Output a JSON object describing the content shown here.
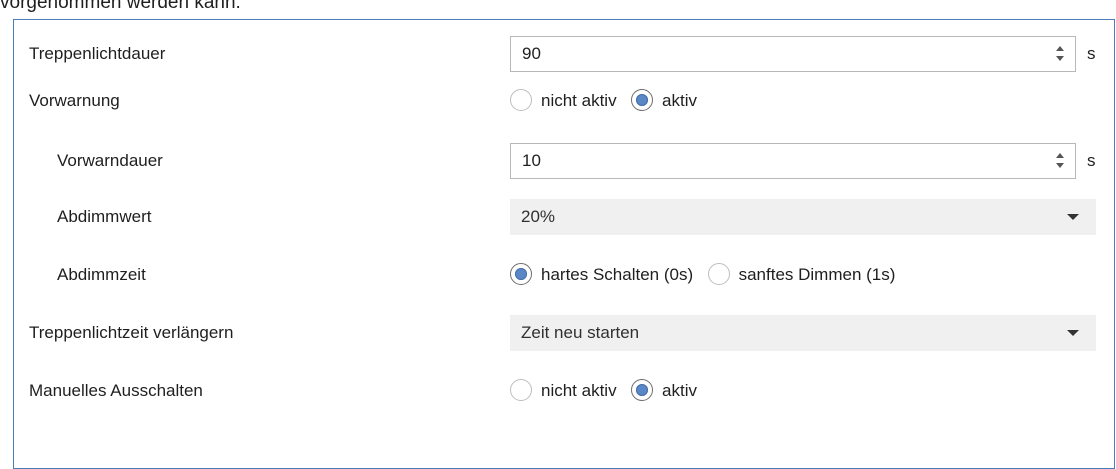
{
  "caption": "vorgenommen werden kann:",
  "rows": [
    {
      "label": "Treppenlichtdauer",
      "value": "90",
      "unit": "s"
    },
    {
      "label": "Vorwarnung",
      "options": [
        "nicht aktiv",
        "aktiv"
      ],
      "selected": "aktiv"
    },
    {
      "label": "Vorwarndauer",
      "value": "10",
      "unit": "s"
    },
    {
      "label": "Abdimmwert",
      "value": "20%"
    },
    {
      "label": "Abdimmzeit",
      "options": [
        "hartes Schalten (0s)",
        "sanftes Dimmen (1s)"
      ],
      "selected": "hartes Schalten (0s)"
    },
    {
      "label": "Treppenlichtzeit verlängern",
      "value": "Zeit neu starten"
    },
    {
      "label": "Manuelles Ausschalten",
      "options": [
        "nicht aktiv",
        "aktiv"
      ],
      "selected": "aktiv"
    }
  ],
  "icons": {
    "spin": "spin-arrows-icon",
    "dropdown": "chevron-down-icon"
  },
  "colors": {
    "panel_border": "#4a7ebb",
    "radio_selected": "#5a88c6",
    "dropdown_bg": "#f0f0f0"
  }
}
